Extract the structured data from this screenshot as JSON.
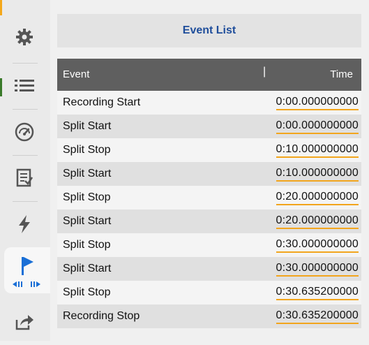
{
  "main": {
    "title": "Event List"
  },
  "table": {
    "headers": {
      "event": "Event",
      "separator": "|",
      "time": "Time"
    },
    "rows": [
      {
        "event": "Recording Start",
        "time": "0:00.000000000"
      },
      {
        "event": "Split Start",
        "time": "0:00.000000000"
      },
      {
        "event": "Split Stop",
        "time": "0:10.000000000"
      },
      {
        "event": "Split Start",
        "time": "0:10.000000000"
      },
      {
        "event": "Split Stop",
        "time": "0:20.000000000"
      },
      {
        "event": "Split Start",
        "time": "0:20.000000000"
      },
      {
        "event": "Split Stop",
        "time": "0:30.000000000"
      },
      {
        "event": "Split Start",
        "time": "0:30.000000000"
      },
      {
        "event": "Split Stop",
        "time": "0:30.635200000"
      },
      {
        "event": "Recording Stop",
        "time": "0:30.635200000"
      }
    ]
  },
  "sidebar": {
    "items": [
      {
        "icon": "gear-icon"
      },
      {
        "icon": "list-icon"
      },
      {
        "icon": "gauge-icon"
      },
      {
        "icon": "report-icon"
      },
      {
        "icon": "lightning-icon"
      },
      {
        "icon": "flag-icon",
        "active": true
      },
      {
        "icon": "export-icon"
      }
    ]
  },
  "colors": {
    "accent": "#f2a51d",
    "title_text": "#1f4e9b",
    "header_bg": "#5f5f5f",
    "flag_blue": "#1a6fd6"
  }
}
